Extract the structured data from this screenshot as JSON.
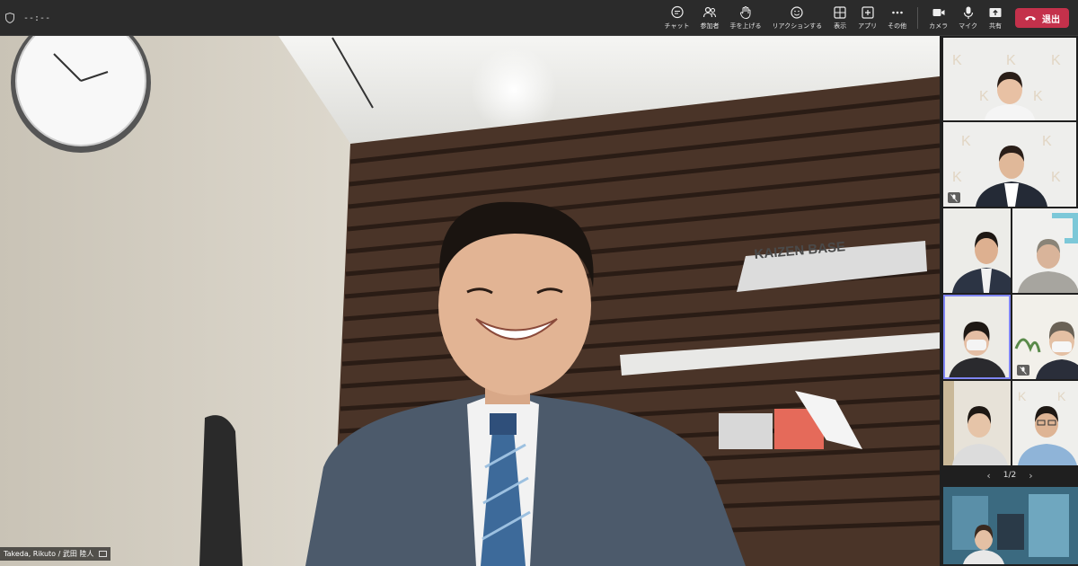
{
  "header": {
    "timer": "--:--",
    "tools": [
      {
        "id": "chat",
        "label": "チャット",
        "icon": "chat-icon"
      },
      {
        "id": "people",
        "label": "参加者",
        "icon": "people-icon"
      },
      {
        "id": "raise",
        "label": "手を上げる",
        "icon": "hand-icon"
      },
      {
        "id": "react",
        "label": "リアクションする",
        "icon": "smiley-icon"
      },
      {
        "id": "view",
        "label": "表示",
        "icon": "grid-icon"
      },
      {
        "id": "apps",
        "label": "アプリ",
        "icon": "plus-square-icon"
      },
      {
        "id": "more",
        "label": "その他",
        "icon": "ellipsis-icon"
      },
      {
        "id": "camera",
        "label": "カメラ",
        "icon": "camera-icon"
      },
      {
        "id": "mic",
        "label": "マイク",
        "icon": "microphone-icon"
      },
      {
        "id": "share",
        "label": "共有",
        "icon": "share-icon"
      }
    ],
    "leave_label": "退出"
  },
  "stage": {
    "speaker_name": "Takeda, Rikuto / 武田 陸人",
    "sign_text": "KAIZEN BASE"
  },
  "gallery": {
    "page_indicator": "1/2"
  },
  "colors": {
    "leave": "#c4314b",
    "active_outline": "#7f85f5",
    "topbar": "#2b2b2b"
  }
}
